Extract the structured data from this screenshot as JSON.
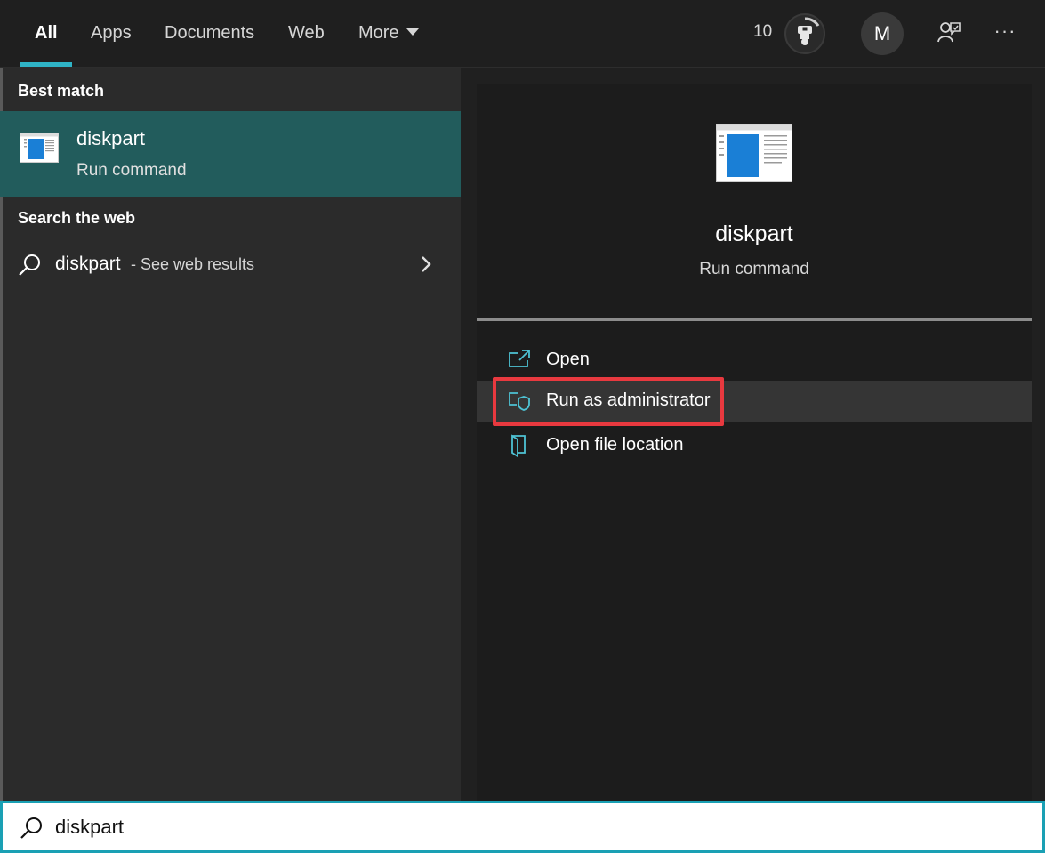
{
  "tabs": [
    {
      "label": "All",
      "active": true
    },
    {
      "label": "Apps"
    },
    {
      "label": "Documents"
    },
    {
      "label": "Web"
    },
    {
      "label": "More"
    }
  ],
  "header": {
    "points": "10",
    "trophy_icon": "trophy-icon",
    "avatar_initial": "M",
    "feedback_icon": "feedback-icon",
    "more_options": "···"
  },
  "left": {
    "best_match_heading": "Best match",
    "best_match": {
      "title": "diskpart",
      "subtitle": "Run command",
      "icon": "app-window-icon"
    },
    "web_heading": "Search the web",
    "web_result": {
      "term": "diskpart",
      "suffix": " - See web results"
    }
  },
  "detail": {
    "title": "diskpart",
    "subtitle": "Run command",
    "actions": [
      {
        "label": "Open",
        "icon": "open-icon"
      },
      {
        "label": "Run as administrator",
        "icon": "shield-icon",
        "highlighted": true
      },
      {
        "label": "Open file location",
        "icon": "file-location-icon"
      }
    ]
  },
  "search": {
    "value": "diskpart"
  },
  "colors": {
    "accent": "#2fb4c6",
    "selected": "#225c5c",
    "highlight": "#e8393f"
  }
}
